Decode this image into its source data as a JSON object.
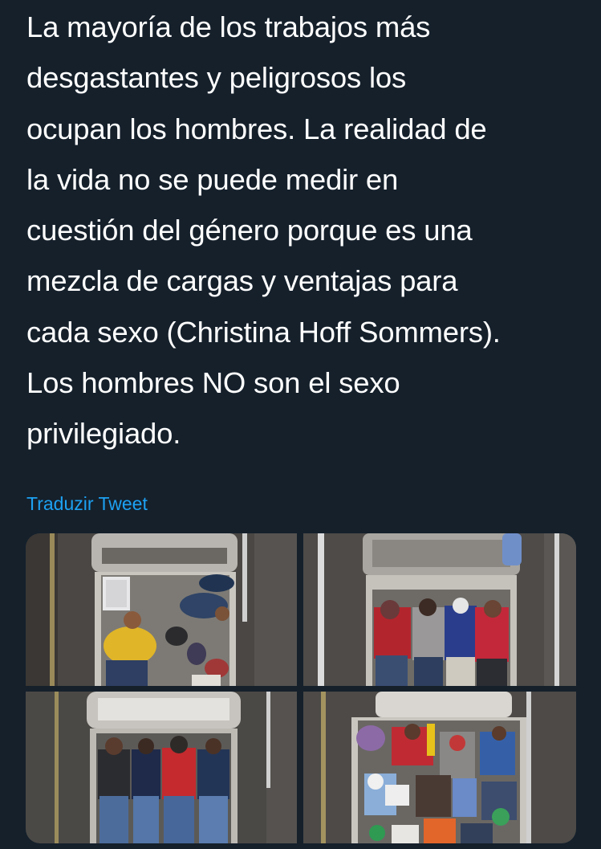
{
  "tweet": {
    "text_lines": [
      "La mayoría de los trabajos más",
      "desgastantes y peligrosos los",
      "ocupan los hombres. La realidad de",
      "la vida no se puede medir en",
      "cuestión del género porque es una",
      "mezcla de cargas y ventajas para",
      "cada sexo (Christina Hoff Sommers).",
      "Los hombres NO son el sexo",
      "privilegiado."
    ],
    "translate_label": "Traduzir Tweet"
  },
  "media": {
    "photo_count": 4,
    "photos": [
      {
        "icon": "truck-bed-photo",
        "subject": "pickup-truck-with-sleeping-workers"
      },
      {
        "icon": "truck-bed-photo",
        "subject": "pickup-truck-with-sleeping-workers"
      },
      {
        "icon": "truck-bed-photo",
        "subject": "pickup-truck-with-sleeping-workers"
      },
      {
        "icon": "truck-bed-photo",
        "subject": "pickup-truck-with-sleeping-workers"
      }
    ]
  },
  "colors": {
    "background": "#15202b",
    "text": "#ffffff",
    "link": "#1da1f2"
  }
}
